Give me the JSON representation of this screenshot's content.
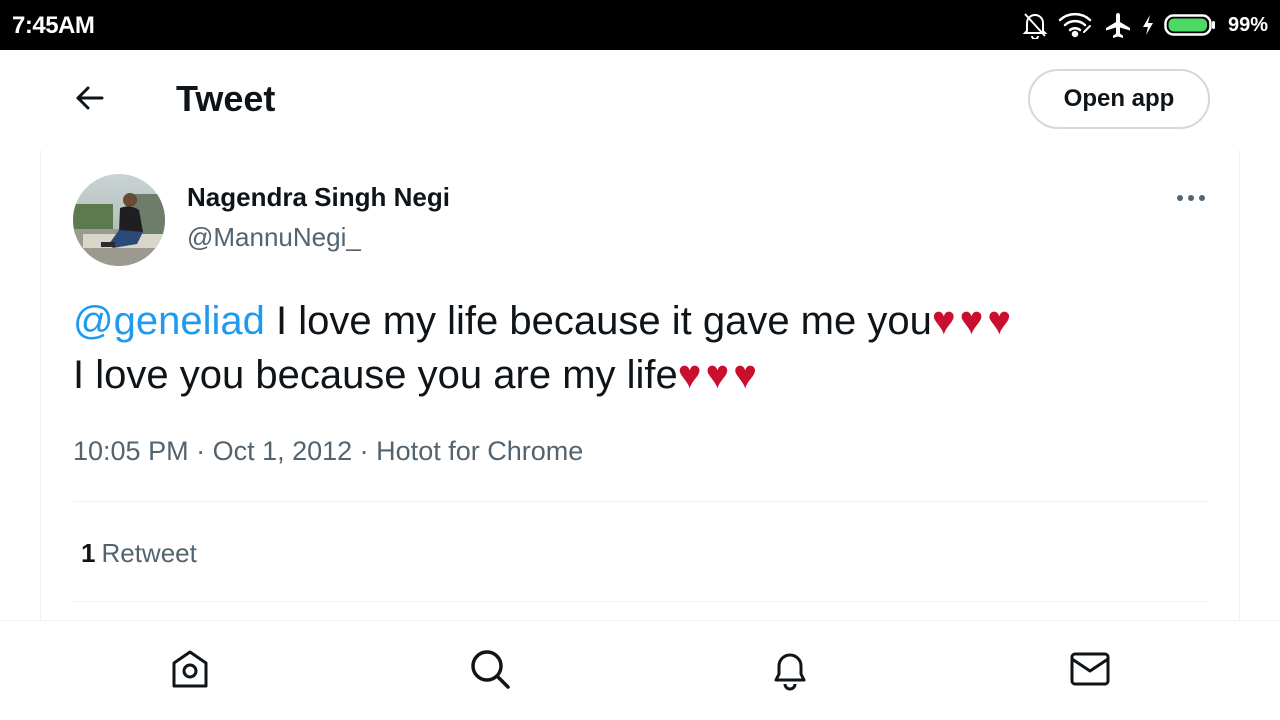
{
  "status_bar": {
    "time": "7:45AM",
    "battery_percent": "99%",
    "battery_level": 0.99,
    "icons": [
      "notifications-off-icon",
      "wifi-icon",
      "airplane-icon",
      "charging-icon",
      "battery-icon"
    ]
  },
  "header": {
    "title": "Tweet",
    "back_icon": "back-arrow-icon",
    "open_app_label": "Open app"
  },
  "tweet": {
    "author_name": "Nagendra Singh Negi",
    "author_handle": "@MannuNegi_",
    "mention": "@geneliad",
    "text_line1": " I love my life because it gave me you",
    "hearts1": "♥♥♥",
    "text_line2": "I love you because you are my life",
    "hearts2": "♥♥♥",
    "time": "10:05 PM",
    "date": "Oct 1, 2012",
    "source": "Hotot for Chrome",
    "separator": " · ",
    "retweet_count": "1",
    "retweet_label": "Retweet",
    "more_icon": "more-options-icon"
  },
  "bottom_nav": {
    "items": [
      {
        "name": "home",
        "icon": "home-icon"
      },
      {
        "name": "explore",
        "icon": "search-icon"
      },
      {
        "name": "notifications",
        "icon": "bell-icon"
      },
      {
        "name": "messages",
        "icon": "mail-icon"
      }
    ]
  },
  "colors": {
    "accent": "#1d9bf0",
    "heart": "#c8102e",
    "text": "#0f1419",
    "secondary": "#536471",
    "border": "#eff3f4"
  }
}
